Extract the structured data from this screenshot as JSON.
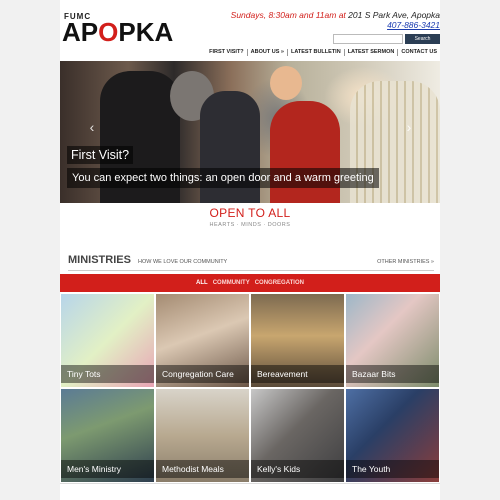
{
  "header": {
    "logo_small": "FUMC",
    "logo_big_pre": "AP",
    "logo_big_cross": "O",
    "logo_big_post": "PKA",
    "service_times": "Sundays, 8:30am and 11am at ",
    "address": "201 S Park Ave, Apopka",
    "phone": "407-886-3421",
    "search_button": "Search",
    "nav": [
      "FIRST VISIT?",
      "ABOUT US »",
      "LATEST BULLETIN",
      "LATEST SERMON",
      "CONTACT US"
    ]
  },
  "hero": {
    "title": "First Visit?",
    "subtitle": "You can expect two things: an open door and a warm greeting",
    "prev_arrow": "‹",
    "next_arrow": "›"
  },
  "open": {
    "title": "OPEN TO ALL",
    "subtitle": "HEARTS · MINDS · DOORS"
  },
  "ministries": {
    "heading": "MINISTRIES",
    "subheading": "HOW WE LOVE OUR COMMUNITY",
    "other_link": "OTHER MINISTRIES »",
    "filters": [
      "ALL",
      "COMMUNITY",
      "CONGREGATION"
    ],
    "active_filter": "ALL",
    "tiles": [
      "Tiny Tots",
      "Congregation Care",
      "Bereavement",
      "Bazaar Bits",
      "Men's Ministry",
      "Methodist Meals",
      "Kelly's Kids",
      "The Youth"
    ]
  },
  "colors": {
    "accent": "#d21f1b",
    "nav_dark": "#2b3e55",
    "link": "#1a3bb0"
  }
}
